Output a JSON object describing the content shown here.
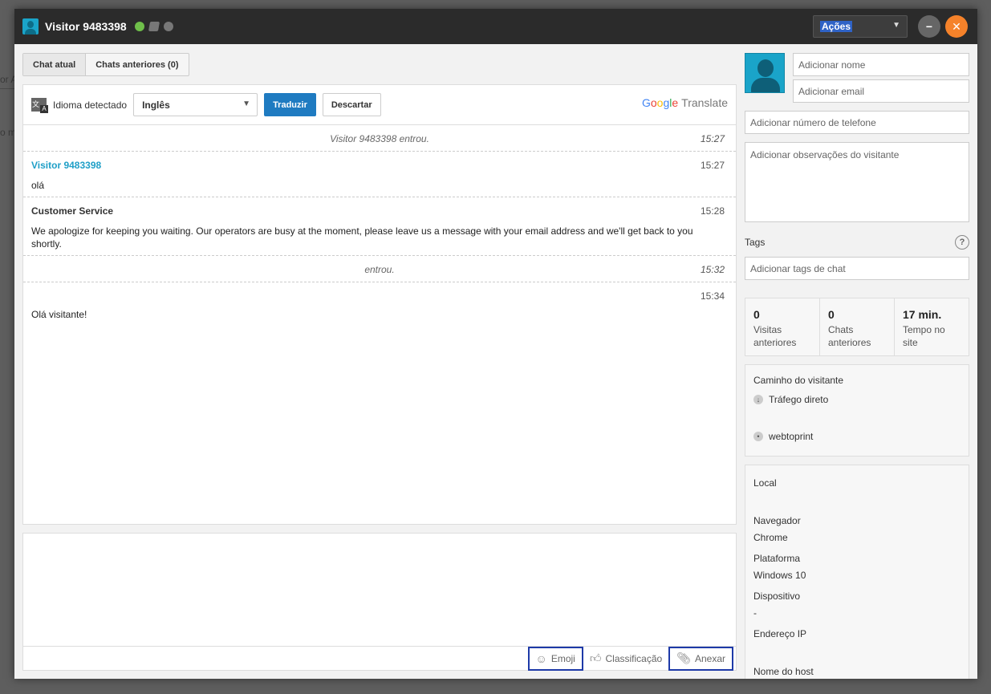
{
  "window": {
    "title": "Visitor 9483398",
    "actions_label": "Ações"
  },
  "tabs": [
    {
      "label": "Chat atual"
    },
    {
      "label": "Chats anteriores (0)"
    }
  ],
  "translate": {
    "detected_label": "Idioma detectado",
    "language": "Inglês",
    "translate_button": "Traduzir",
    "discard_button": "Descartar",
    "brand_g1": "G",
    "brand_o1": "o",
    "brand_o2": "o",
    "brand_g2": "g",
    "brand_l": "l",
    "brand_e": "e",
    "brand_suffix": "Translate"
  },
  "messages": [
    {
      "type": "system",
      "text": "Visitor 9483398 entrou.",
      "time": "15:27"
    },
    {
      "type": "visitor",
      "author": "Visitor 9483398",
      "text": "olá",
      "time": "15:27"
    },
    {
      "type": "operator",
      "author": "Customer Service",
      "text": "We apologize for keeping you waiting. Our operators are busy at the moment, please leave us a message with your email address and we'll get back to you shortly.",
      "time": "15:28"
    },
    {
      "type": "system",
      "text": "entrou.",
      "time": "15:32"
    },
    {
      "type": "operator",
      "author": "",
      "text": "Olá visitante!",
      "time": "15:34"
    }
  ],
  "compose": {
    "emoji_label": "Emoji",
    "rating_label": "Classificação",
    "attach_label": "Anexar"
  },
  "visitor": {
    "name_placeholder": "Adicionar nome",
    "email_placeholder": "Adicionar email",
    "phone_placeholder": "Adicionar número de telefone",
    "notes_placeholder": "Adicionar observações do visitante",
    "tags_label": "Tags",
    "tags_placeholder": "Adicionar tags de chat",
    "help": "?"
  },
  "stats": [
    {
      "value": "0",
      "label": "Visitas anteriores"
    },
    {
      "value": "0",
      "label": "Chats anteriores"
    },
    {
      "value": "17 min.",
      "label": "Tempo no site"
    }
  ],
  "path": {
    "title": "Caminho do visitante",
    "items": [
      "Tráfego direto",
      "webtoprint"
    ]
  },
  "info": {
    "local_label": "Local",
    "browser_label": "Navegador",
    "browser_value": "Chrome",
    "platform_label": "Plataforma",
    "platform_value": "Windows 10",
    "device_label": "Dispositivo",
    "device_value": "-",
    "ip_label": "Endereço IP",
    "host_label": "Nome do host"
  },
  "background": {
    "text1": "or A",
    "text2": "o m"
  }
}
